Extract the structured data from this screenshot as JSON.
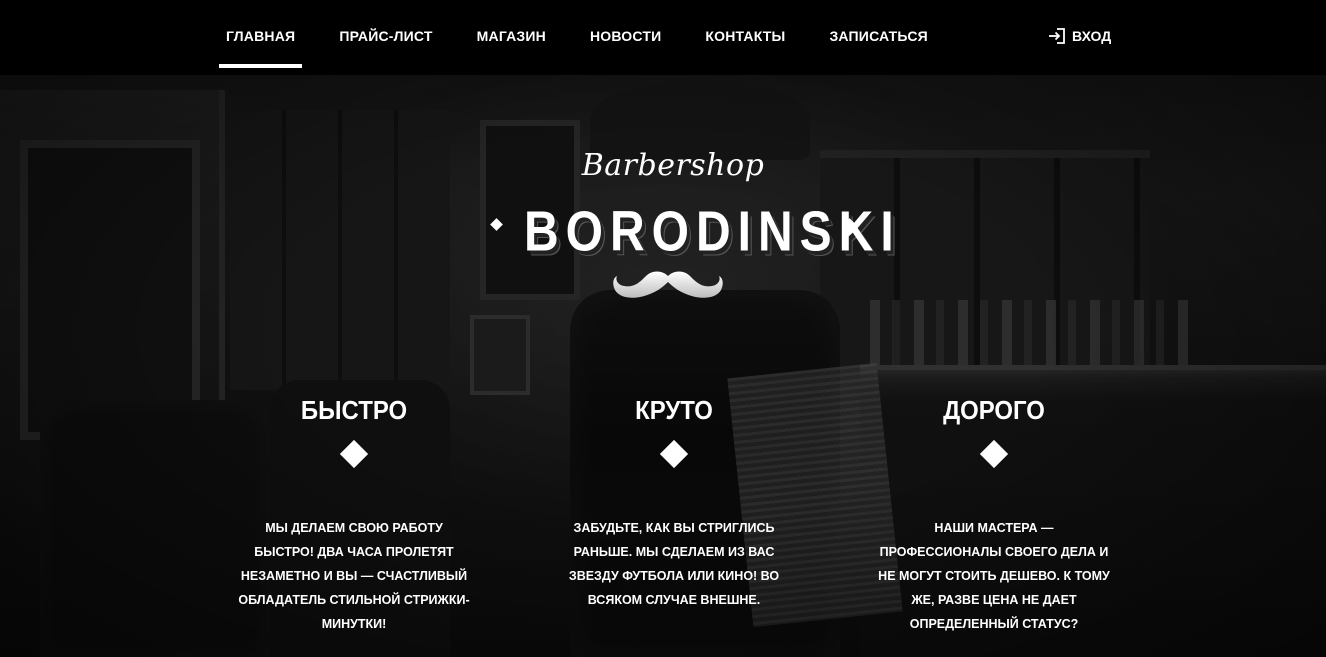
{
  "nav": {
    "items": [
      {
        "label": "ГЛАВНАЯ",
        "active": true
      },
      {
        "label": "ПРАЙС-ЛИСТ",
        "active": false
      },
      {
        "label": "МАГАЗИН",
        "active": false
      },
      {
        "label": "НОВОСТИ",
        "active": false
      },
      {
        "label": "КОНТАКТЫ",
        "active": false
      },
      {
        "label": "ЗАПИСАТЬСЯ",
        "active": false
      }
    ],
    "login": {
      "label": "ВХОД",
      "icon": "login-icon"
    }
  },
  "logo": {
    "script": "Barbershop",
    "brand": "BORODINSKI",
    "emblem": "mustache-icon"
  },
  "features": [
    {
      "title": "БЫСТРО",
      "text": "Мы делаем свою работу быстро! Два часа пролетят незаметно и вы — счастливый обладатель стильной стрижки-минутки!"
    },
    {
      "title": "КРУТО",
      "text": "Забудьте, как вы стриглись раньше. Мы сделаем из вас звезду футбола или кино! Во всяком случае внешне."
    },
    {
      "title": "ДОРОГО",
      "text": "Наши мастера — профессионалы своего дела и не могут стоить дешево. К тому же, разве цена не дает определенный статус?"
    }
  ],
  "colors": {
    "header_bg": "#000000",
    "text": "#ffffff",
    "accent": "#ffffff"
  }
}
